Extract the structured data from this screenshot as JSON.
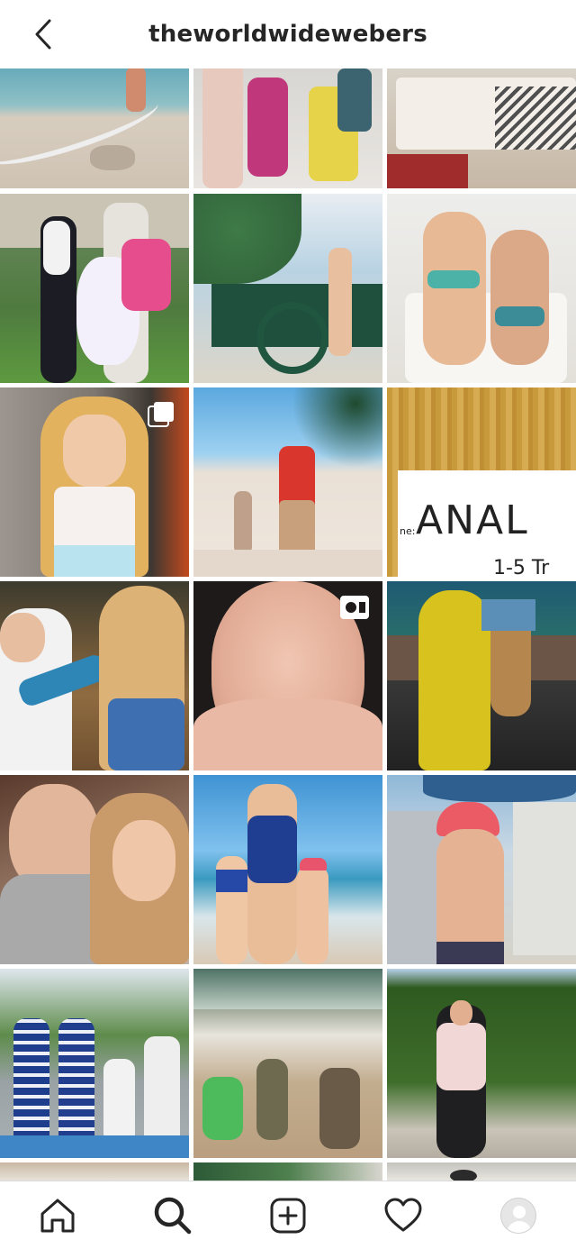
{
  "header": {
    "title": "theworldwidewebers",
    "back_icon": "chevron-left-icon"
  },
  "grid": {
    "tiles": [
      {
        "id": "beach-shore",
        "badge": null
      },
      {
        "id": "toy-figures",
        "badge": null
      },
      {
        "id": "bedroom",
        "badge": null
      },
      {
        "id": "family-halloween",
        "badge": null
      },
      {
        "id": "pool-playground",
        "badge": null
      },
      {
        "id": "kids-on-lounger",
        "badge": null
      },
      {
        "id": "girl-unicorn-shirt",
        "badge": "carousel-icon"
      },
      {
        "id": "beach-father-kids",
        "badge": null
      },
      {
        "id": "name-worksheet",
        "badge": null
      },
      {
        "id": "siblings-hair",
        "badge": null
      },
      {
        "id": "baby-closeup",
        "badge": "video-icon"
      },
      {
        "id": "dinosaur-costume",
        "badge": null
      },
      {
        "id": "mother-daughter-selfie",
        "badge": null
      },
      {
        "id": "mom-beach-kids",
        "badge": null
      },
      {
        "id": "toddler-pink-cap",
        "badge": null
      },
      {
        "id": "four-kids-street",
        "badge": null
      },
      {
        "id": "kids-waves",
        "badge": null
      },
      {
        "id": "woman-lookout",
        "badge": null
      }
    ],
    "worksheet": {
      "label": "ne:",
      "name": "ANAL",
      "footer": "1-5 Tr"
    }
  },
  "bottom_nav": {
    "items": [
      {
        "name": "home",
        "icon": "home-icon"
      },
      {
        "name": "search",
        "icon": "search-icon"
      },
      {
        "name": "new-post",
        "icon": "plus-square-icon"
      },
      {
        "name": "activity",
        "icon": "heart-icon"
      },
      {
        "name": "profile",
        "icon": "avatar"
      }
    ]
  },
  "colors": {
    "text": "#262626",
    "border": "#dbdbdb",
    "background": "#ffffff"
  }
}
